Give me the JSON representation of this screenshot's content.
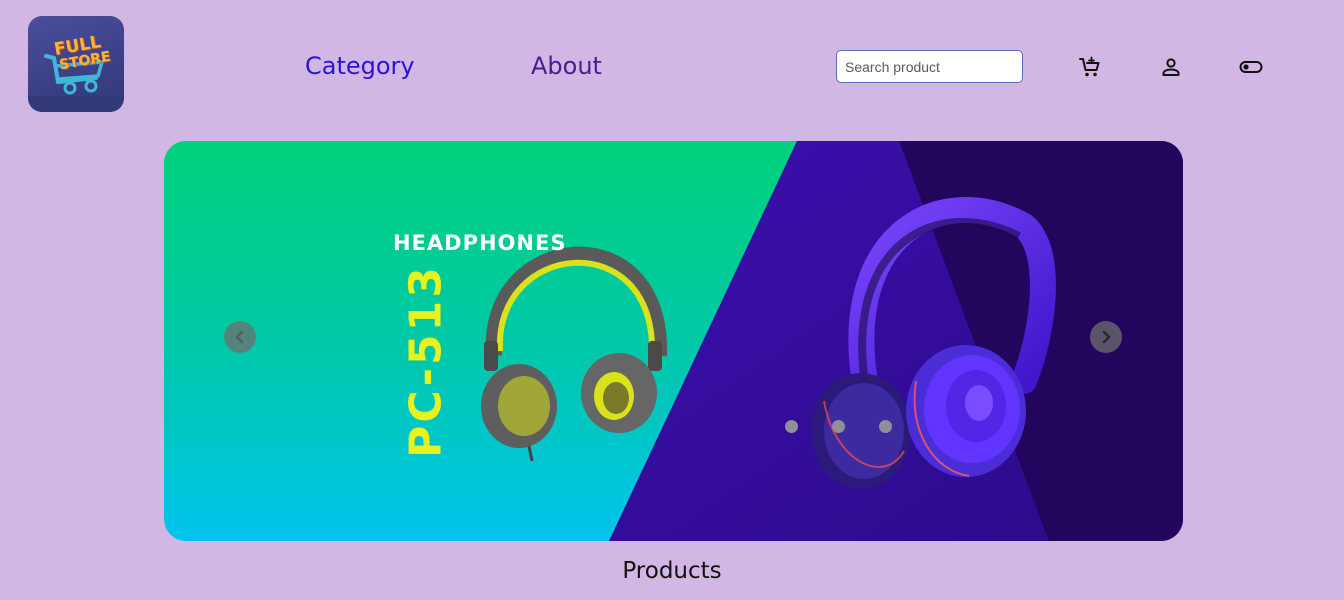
{
  "header": {
    "logo": {
      "line1": "FULL",
      "line2": "STORE",
      "icon": "shopping-cart-logo"
    },
    "nav": [
      {
        "label": "Category",
        "color": "#2a14d6"
      },
      {
        "label": "About",
        "color": "#4a1d8c"
      }
    ],
    "search": {
      "placeholder": "Search product",
      "value": ""
    },
    "icons": [
      "add-to-cart-icon",
      "user-icon",
      "theme-toggle-icon"
    ]
  },
  "hero": {
    "headline": "HEADPHONES",
    "model": "PC-513",
    "prev_icon": "chevron-left-icon",
    "next_icon": "chevron-right-icon",
    "slide_count": 3,
    "colors": {
      "left_top": "#00d17c",
      "left_bottom": "#00c4ec",
      "right": "#2e0a8c",
      "accent": "#e8f21c"
    }
  },
  "products": {
    "title": "Products"
  },
  "theme": {
    "background": "#d2b6e4"
  }
}
